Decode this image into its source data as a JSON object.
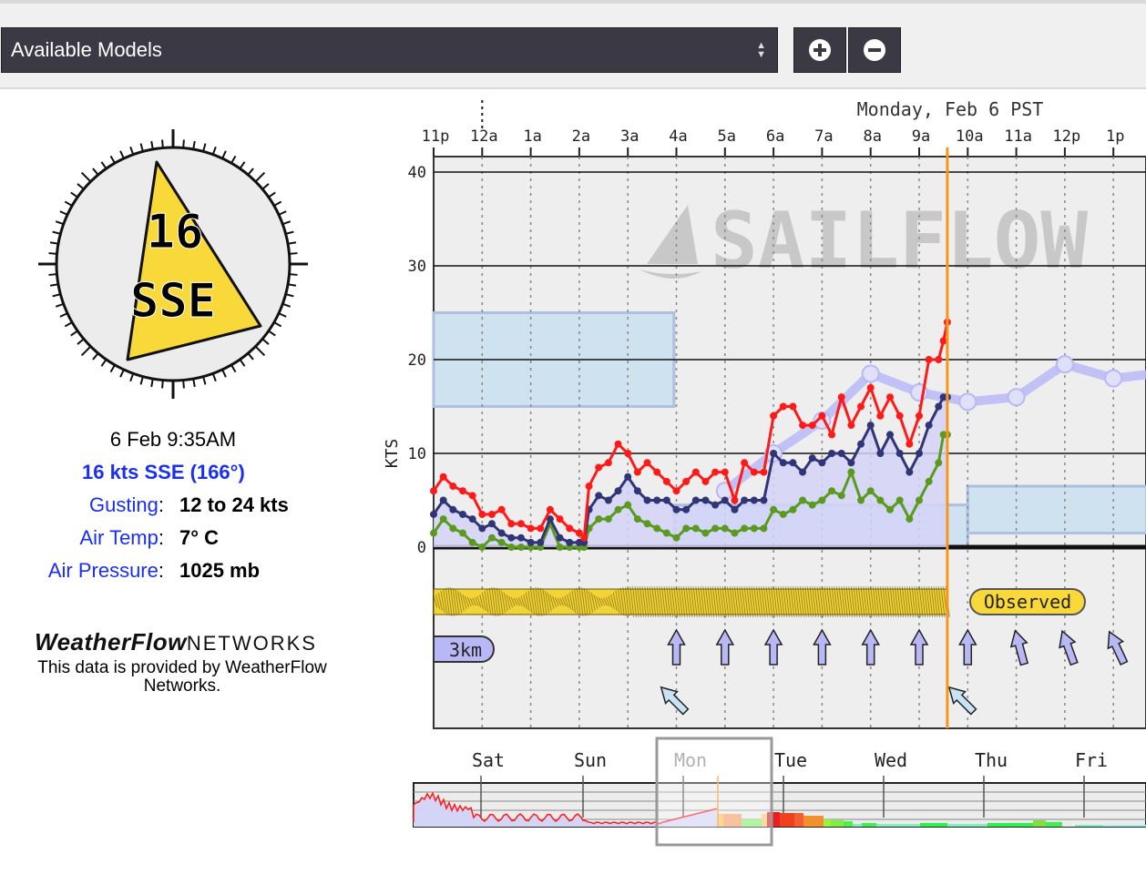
{
  "toolbar": {
    "model_select_label": "Available Models",
    "zoom_in_icon": "plus-circle-icon",
    "zoom_out_icon": "minus-circle-icon"
  },
  "compass": {
    "speed": "16",
    "direction": "SSE",
    "degrees": 166,
    "arrow_color": "#f9d93a"
  },
  "observation": {
    "timestamp": "6 Feb 9:35AM",
    "wind_summary": "16 kts SSE (166°)",
    "rows": [
      {
        "label": "Gusting",
        "value": "12 to 24 kts"
      },
      {
        "label": "Air Temp",
        "value": "7° C"
      },
      {
        "label": "Air Pressure",
        "value": "1025 mb"
      }
    ]
  },
  "provider": {
    "logo_main": "WeatherFlow",
    "logo_sub": "NETWORKS",
    "credit": "This data is provided by WeatherFlow Networks."
  },
  "colors": {
    "gust": "#ff1a1a",
    "avg": "#2f3577",
    "lull": "#5a9a1e",
    "model": "#b8b8f6",
    "now_line": "#f7961e",
    "label_blue": "#1a2ff0"
  },
  "chart_data": {
    "type": "line",
    "title": "Monday, Feb 6 PST",
    "watermark": "SAILFLOW",
    "ylabel": "KTS",
    "xlabel": "",
    "ylim": [
      0,
      40
    ],
    "yticks": [
      0,
      10,
      20,
      30,
      40
    ],
    "x_ticks": [
      "11p",
      "12a",
      "1a",
      "2a",
      "3a",
      "4a",
      "5a",
      "6a",
      "7a",
      "8a",
      "9a",
      "10a",
      "11a",
      "12p",
      "1p"
    ],
    "x_range_hours": [
      -1,
      14.7
    ],
    "now_hour": 9.58,
    "grid": true,
    "series": [
      {
        "name": "Gust",
        "x": [
          -1,
          -0.8,
          -0.6,
          -0.4,
          -0.2,
          0,
          0.2,
          0.4,
          0.6,
          0.8,
          1,
          1.2,
          1.4,
          1.6,
          1.8,
          2,
          2.1,
          2.2,
          2.4,
          2.6,
          2.8,
          3,
          3.2,
          3.4,
          3.6,
          3.8,
          4,
          4.2,
          4.4,
          4.6,
          4.8,
          5,
          5.2,
          5.4,
          5.6,
          5.8,
          6,
          6.2,
          6.4,
          6.6,
          6.8,
          7,
          7.2,
          7.4,
          7.6,
          7.8,
          8,
          8.2,
          8.4,
          8.6,
          8.8,
          9,
          9.2,
          9.4,
          9.5,
          9.58
        ],
        "values": [
          6,
          7.5,
          6.5,
          6,
          5.5,
          3.5,
          3.5,
          4,
          2.5,
          2.5,
          2,
          2,
          4,
          3,
          2,
          1.5,
          1,
          6.5,
          8.5,
          9,
          11,
          10,
          8,
          9,
          8,
          7,
          6,
          7,
          8,
          7,
          8,
          8,
          5,
          9,
          8,
          8,
          14,
          15,
          15,
          13,
          13,
          14,
          12,
          16,
          13,
          15,
          17,
          14,
          16,
          14,
          11,
          14,
          20,
          20,
          22,
          24
        ]
      },
      {
        "name": "Average",
        "x": [
          -1,
          -0.8,
          -0.6,
          -0.4,
          -0.2,
          0,
          0.2,
          0.4,
          0.6,
          0.8,
          1,
          1.2,
          1.4,
          1.6,
          1.8,
          2,
          2.1,
          2.2,
          2.4,
          2.6,
          2.8,
          3,
          3.2,
          3.4,
          3.6,
          3.8,
          4,
          4.2,
          4.4,
          4.6,
          4.8,
          5,
          5.2,
          5.4,
          5.6,
          5.8,
          6,
          6.2,
          6.4,
          6.6,
          6.8,
          7,
          7.2,
          7.4,
          7.6,
          7.8,
          8,
          8.2,
          8.4,
          8.6,
          8.8,
          9,
          9.2,
          9.4,
          9.5,
          9.58
        ],
        "values": [
          3.5,
          5,
          4,
          3.5,
          3,
          2,
          2.5,
          1.5,
          1,
          1,
          0.5,
          0.5,
          3,
          1,
          0.5,
          0.5,
          0.5,
          4,
          5.5,
          5,
          6,
          7.5,
          6,
          5,
          5,
          5,
          4,
          4,
          5,
          5,
          4.5,
          5,
          4,
          5,
          5,
          5,
          10,
          9,
          9,
          8,
          9.5,
          9,
          10,
          10,
          9,
          11,
          13,
          10,
          12,
          10,
          8,
          10,
          13,
          15,
          16,
          16
        ]
      },
      {
        "name": "Lull",
        "x": [
          -1,
          -0.8,
          -0.6,
          -0.4,
          -0.2,
          0,
          0.2,
          0.4,
          0.6,
          0.8,
          1,
          1.2,
          1.4,
          1.6,
          1.8,
          2,
          2.1,
          2.2,
          2.4,
          2.6,
          2.8,
          3,
          3.2,
          3.4,
          3.6,
          3.8,
          4,
          4.2,
          4.4,
          4.6,
          4.8,
          5,
          5.2,
          5.4,
          5.6,
          5.8,
          6,
          6.2,
          6.4,
          6.6,
          6.8,
          7,
          7.2,
          7.4,
          7.6,
          7.8,
          8,
          8.2,
          8.4,
          8.6,
          8.8,
          9,
          9.2,
          9.4,
          9.5,
          9.58
        ],
        "values": [
          1.5,
          3,
          2,
          1.5,
          0.5,
          0,
          1,
          0.5,
          0,
          0,
          0,
          0,
          2.5,
          0,
          0,
          0,
          0,
          2,
          3,
          3,
          4,
          4.5,
          3,
          2.5,
          2,
          1.5,
          1,
          2,
          2,
          1.5,
          2,
          2,
          1.5,
          2,
          2,
          2,
          4,
          3.5,
          4,
          5,
          4.5,
          5,
          6,
          5.5,
          8,
          5,
          6,
          5,
          4,
          5,
          3,
          5,
          7,
          9,
          12,
          12
        ]
      },
      {
        "name": "Model forecast",
        "x": [
          5,
          6,
          7,
          8,
          9,
          10,
          11,
          12,
          13,
          14.7
        ],
        "values": [
          6,
          10,
          13.5,
          18.5,
          16.5,
          15.5,
          16,
          19.5,
          18,
          19
        ]
      }
    ],
    "bands": [
      {
        "name": "Forecast range (earlier)",
        "x": [
          -1,
          3.95
        ],
        "low": 15,
        "high": 25
      },
      {
        "name": "Forecast range (low)",
        "x": [
          3.95,
          10
        ],
        "low": 0,
        "high": 4.5
      },
      {
        "name": "Forecast range (later)",
        "x": [
          10,
          14.7
        ],
        "low": 1.5,
        "high": 6.5
      }
    ],
    "direction_labels": [
      "3km",
      "Observed"
    ],
    "direction_arrows_3km_degrees": [
      150,
      180,
      180,
      180,
      180,
      180,
      180,
      180,
      165,
      160,
      155,
      150
    ],
    "overview": {
      "day_labels": [
        "Sat",
        "Sun",
        "Mon",
        "Tue",
        "Wed",
        "Thu",
        "Fri"
      ],
      "selected_day": "Mon"
    }
  }
}
